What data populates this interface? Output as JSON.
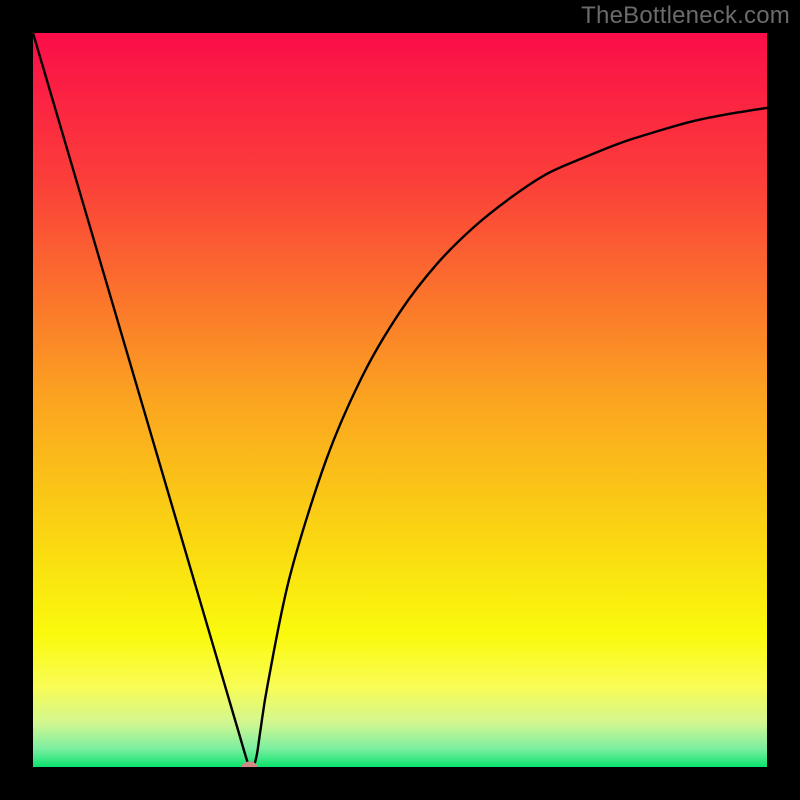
{
  "watermark": {
    "text": "TheBottleneck.com"
  },
  "chart_data": {
    "type": "line",
    "title": "",
    "xlabel": "",
    "ylabel": "",
    "xlim": [
      0,
      100
    ],
    "ylim": [
      0,
      100
    ],
    "grid": false,
    "legend": false,
    "series": [
      {
        "name": "curve",
        "x": [
          0,
          5,
          10,
          15,
          20,
          25,
          28,
          29,
          29.5,
          30,
          30.5,
          31,
          32,
          35,
          40,
          45,
          50,
          55,
          60,
          65,
          70,
          75,
          80,
          85,
          90,
          95,
          100
        ],
        "y": [
          100,
          83,
          66,
          49,
          32,
          15,
          4.8,
          1.4,
          0,
          0,
          1.7,
          5.1,
          11.4,
          26,
          42,
          53.5,
          62,
          68.5,
          73.5,
          77.5,
          80.8,
          83,
          85,
          86.6,
          88,
          89,
          89.8
        ],
        "color": "#000000"
      }
    ],
    "marker": {
      "x": 29.5,
      "y": 0,
      "color": "#d18a85"
    },
    "background": {
      "type": "vertical_gradient",
      "stops": [
        {
          "pos": 0.0,
          "color": "#fb0d49"
        },
        {
          "pos": 0.21,
          "color": "#fb4139"
        },
        {
          "pos": 0.5,
          "color": "#fba420"
        },
        {
          "pos": 0.7,
          "color": "#fada11"
        },
        {
          "pos": 0.82,
          "color": "#fafa0d"
        },
        {
          "pos": 0.89,
          "color": "#f9fc54"
        },
        {
          "pos": 0.94,
          "color": "#d2f791"
        },
        {
          "pos": 0.975,
          "color": "#7ceea0"
        },
        {
          "pos": 1.0,
          "color": "#0ae46d"
        }
      ]
    }
  }
}
